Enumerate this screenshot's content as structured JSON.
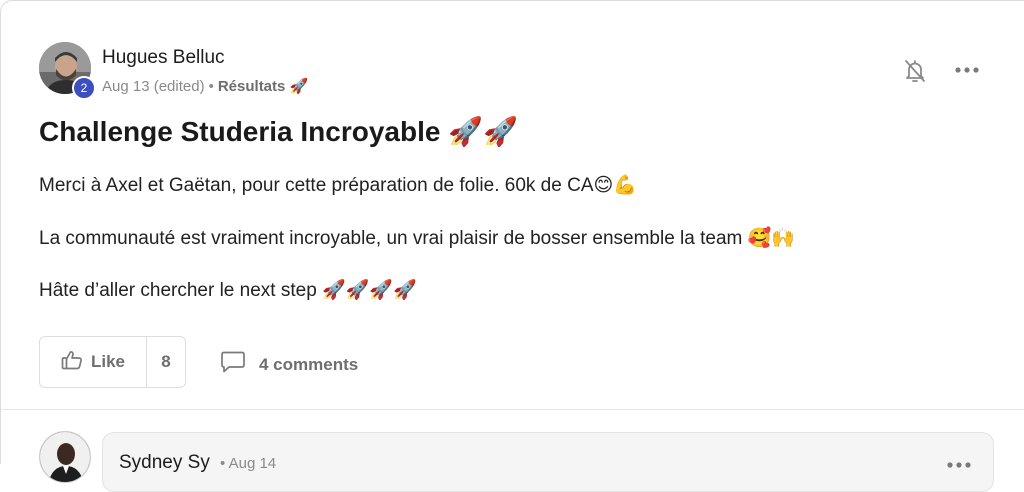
{
  "post": {
    "author": {
      "name": "Hugues Belluc",
      "level": "2"
    },
    "meta": {
      "date": "Aug 13 (edited)",
      "separator": "•",
      "space": "Résultats",
      "space_emoji": "🚀"
    },
    "title": "Challenge Studeria Incroyable",
    "title_emoji": "🚀🚀",
    "paragraphs": [
      {
        "text": "Merci à Axel et Gaëtan, pour cette préparation de folie. 60k de CA",
        "emoji": "😊💪"
      },
      {
        "text": "La communauté est vraiment incroyable, un vrai plaisir de bosser ensemble la team ",
        "emoji": "🥰🙌"
      },
      {
        "text": "Hâte d’aller chercher le next step ",
        "emoji": "🚀🚀🚀🚀"
      }
    ],
    "actions": {
      "like_label": "Like",
      "like_count": "8",
      "comments_label": "4 comments"
    },
    "icons": [
      "bell-icon",
      "more-icon",
      "thumbs-up-icon",
      "comment-icon"
    ]
  },
  "comment": {
    "author": "Sydney Sy",
    "separator": "•",
    "date": "Aug 14"
  },
  "colors": {
    "level_badge": "#3b4fbf",
    "muted_text": "#8a8a8a"
  }
}
